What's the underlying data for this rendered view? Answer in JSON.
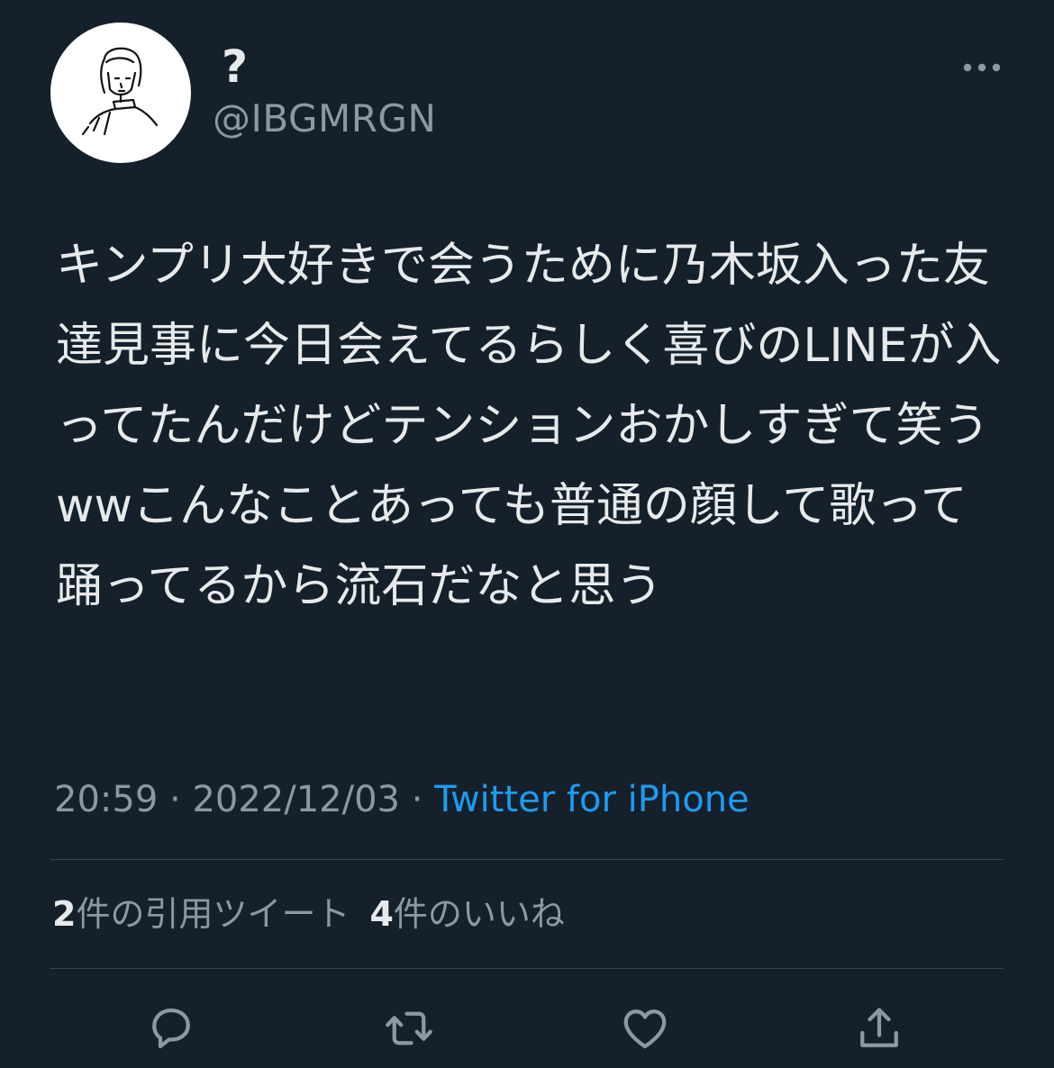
{
  "author": {
    "display_name": "?",
    "handle": "@IBGMRGN"
  },
  "tweet": {
    "text": "キンプリ大好きで会うために乃木坂入った友達見事に今日会えてるらしく喜びのLINEが入ってたんだけどテンションおかしすぎて笑うwwこんなことあっても普通の顔して歌って踊ってるから流石だなと思う"
  },
  "meta": {
    "time": "20:59",
    "separator": " · ",
    "date": "2022/12/03",
    "source": "Twitter for iPhone"
  },
  "stats": {
    "quote_count": "2",
    "quote_label": "件の引用ツイート",
    "like_count": "4",
    "like_label": "件のいいね"
  },
  "icons": {
    "more": "more-dots-icon",
    "reply": "reply-bubble-icon",
    "retweet": "retweet-arrows-icon",
    "like": "heart-icon",
    "share": "share-upload-icon"
  },
  "colors": {
    "background": "#15202b",
    "text": "#e7e9ea",
    "secondary": "#8b98a5",
    "accent": "#1d9bf0",
    "divider": "#38444d"
  }
}
